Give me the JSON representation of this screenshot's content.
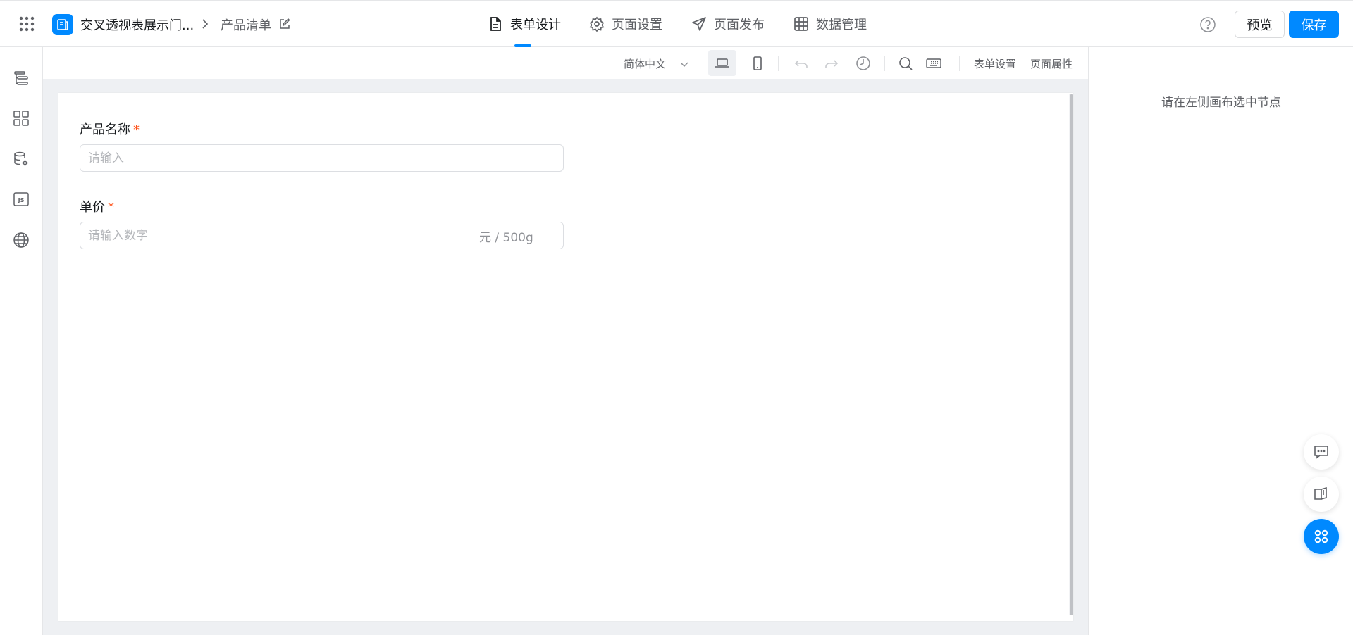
{
  "header": {
    "app_name": "交叉透视表展示门...",
    "page_name": "产品清单",
    "tabs": [
      {
        "label": "表单设计",
        "icon": "document-icon",
        "active": true
      },
      {
        "label": "页面设置",
        "icon": "gear-icon",
        "active": false
      },
      {
        "label": "页面发布",
        "icon": "send-icon",
        "active": false
      },
      {
        "label": "数据管理",
        "icon": "table-grid-icon",
        "active": false
      }
    ],
    "preview_label": "预览",
    "save_label": "保存"
  },
  "toolbar": {
    "language": "简体中文",
    "form_settings_label": "表单设置",
    "page_props_label": "页面属性"
  },
  "form": {
    "fields": [
      {
        "label": "产品名称",
        "required_mark": "*",
        "placeholder": "请输入",
        "value": ""
      },
      {
        "label": "单价",
        "required_mark": "*",
        "placeholder": "请输入数字",
        "suffix": "元 / 500g",
        "value": ""
      }
    ]
  },
  "right_panel": {
    "hint": "请在左侧画布选中节点"
  },
  "colors": {
    "accent": "#0089ff",
    "required": "#ff5219",
    "canvas_bg": "#eef0f3"
  }
}
